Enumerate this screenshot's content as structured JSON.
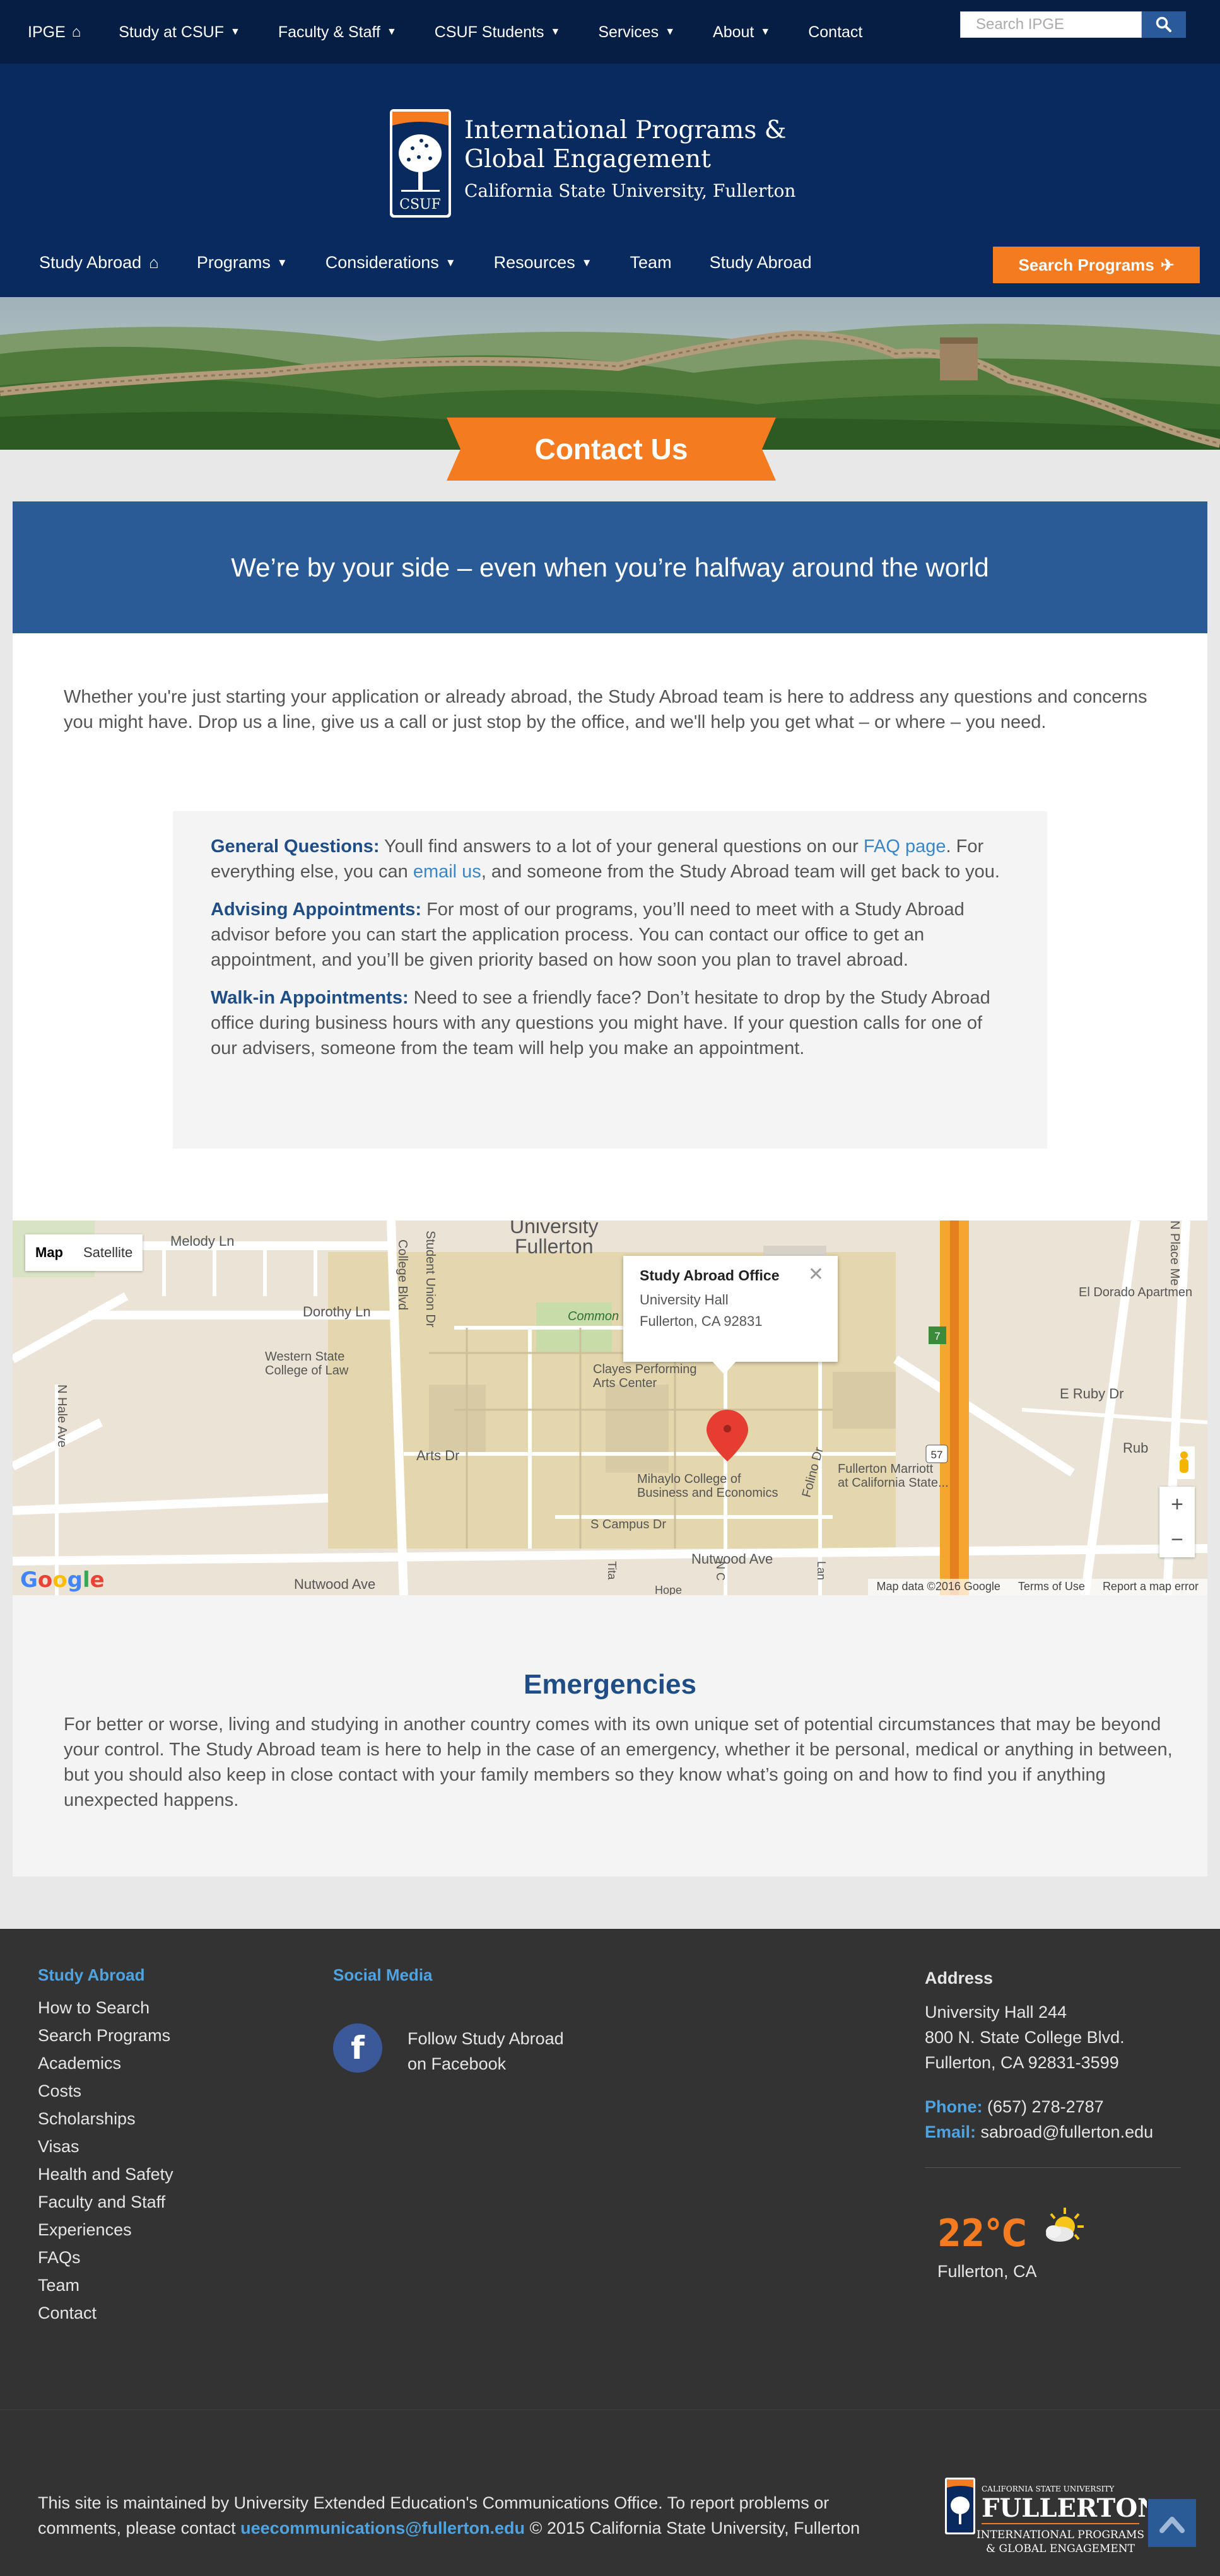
{
  "topbar": {
    "nav": [
      {
        "label": "IPGE",
        "icon": "home-icon"
      },
      {
        "label": "Study at CSUF",
        "icon": "caret-down-icon"
      },
      {
        "label": "Faculty & Staff",
        "icon": "caret-down-icon"
      },
      {
        "label": "CSUF Students",
        "icon": "caret-down-icon"
      },
      {
        "label": "Services",
        "icon": "caret-down-icon"
      },
      {
        "label": "About",
        "icon": "caret-down-icon"
      },
      {
        "label": "Contact",
        "icon": ""
      }
    ],
    "search_placeholder": "Search IPGE"
  },
  "header": {
    "logo_text": "CSUF",
    "title": "International Programs & Global Engagement",
    "subtitle": "California State University, Fullerton",
    "nav": [
      {
        "label": "Study Abroad",
        "icon": "home-icon"
      },
      {
        "label": "Programs",
        "icon": "caret-down-icon"
      },
      {
        "label": "Considerations",
        "icon": "caret-down-icon"
      },
      {
        "label": "Resources",
        "icon": "caret-down-icon"
      },
      {
        "label": "Team",
        "icon": ""
      },
      {
        "label": "Study Abroad",
        "icon": ""
      }
    ],
    "search_programs": "Search Programs"
  },
  "hero": {
    "title": "Contact Us"
  },
  "tagline": "We’re by your side – even when you’re halfway around the world",
  "intro": "Whether you're just starting your application or already abroad, the Study Abroad team is here to address any questions and concerns you might have. Drop us a line, give us a call or just stop by the office, and we'll help you get what – or where – you need.",
  "info": {
    "general": {
      "heading": "General Questions:",
      "text1": " Youll find answers to a lot of your general questions on our ",
      "link1": "FAQ page",
      "text2": ". For everything else, you can ",
      "link2": "email us",
      "text3": ", and someone from the Study Abroad team will get back to you."
    },
    "advising": {
      "heading": "Advising Appointments:",
      "text": " For most of our programs, you’ll need to meet with a Study Abroad advisor before you can start the application process. You can contact our office to get an appointment, and you’ll be given priority based on how soon you plan to travel abroad."
    },
    "walkin": {
      "heading": "Walk-in Appointments:",
      "text": " Need to see a friendly face? Don’t hesitate to drop by the Study Abroad office during business hours with any questions you might have. If your question calls for one of our advisers, someone from the team will help you make an appointment."
    }
  },
  "map": {
    "types": [
      "Map",
      "Satellite"
    ],
    "info_title": "Study Abroad Office",
    "info_lines": [
      "University Hall",
      "Fullerton, CA 92831"
    ],
    "labels": {
      "university": "University",
      "fullerton": "Fullerton",
      "melody": "Melody Ln",
      "dorothy": "Dorothy Ln",
      "western1": "Western State",
      "western2": "College of Law",
      "n_hale": "N Hale Ave",
      "college_blvd": "College Blvd",
      "student_union": "Student Union Dr",
      "arts": "Arts Dr",
      "clayes1": "Clayes Performing",
      "clayes2": "Arts Center",
      "mihaylo1": "Mihaylo College of",
      "mihaylo2": "Business and Economics",
      "campus_dr": "S Campus Dr",
      "nutwood1": "Nutwood Ave",
      "nutwood2": "Nutwood Ave",
      "common": "Common",
      "folino": "Folino Dr",
      "marriott1": "Fullerton Marriott",
      "marriott2": "at California State...",
      "e_ruby": "E Ruby Dr",
      "ruby": "Rub",
      "eldorado": "El Dorado Apartmen",
      "n_place": "N Place Me",
      "hope": "Hope",
      "titan": "Tita",
      "lan": "Lan",
      "nc": "N C",
      "route57": "57",
      "route7": "7"
    },
    "footer": [
      "Map data ©2016 Google",
      "Terms of Use",
      "Report a map error"
    ],
    "google": [
      "G",
      "o",
      "o",
      "g",
      "l",
      "e"
    ]
  },
  "emergencies": {
    "heading": "Emergencies",
    "text": "For better or worse, living and studying in another country comes with its own unique set of potential circumstances that may be beyond your control. The Study Abroad team is here to help in the case of an emergency, whether it be personal, medical or anything in between, but you should also keep in close contact with your family members so they know what’s going on and how to find you if anything unexpected happens."
  },
  "footer": {
    "study_abroad": {
      "heading": "Study Abroad",
      "links": [
        "How to Search",
        "Search Programs",
        "Academics",
        "Costs",
        "Scholarships",
        "Visas",
        "Health and Safety",
        "Faculty and Staff",
        "Experiences",
        "FAQs",
        "Team",
        "Contact"
      ]
    },
    "social": {
      "heading": "Social Media",
      "fb_line1": "Follow Study Abroad",
      "fb_line2": "on Facebook"
    },
    "address": {
      "heading": "Address",
      "lines": [
        "University Hall 244",
        "800 N. State College Blvd.",
        "Fullerton, CA 92831-3599"
      ],
      "phone_label": "Phone:",
      "phone": " (657) 278-2787",
      "email_label": "Email:",
      "email": " sabroad@fullerton.edu"
    },
    "weather": {
      "temp": "22°C",
      "city": "Fullerton, CA"
    },
    "bottom": {
      "text1": "This site is maintained by University Extended Education's Communications Office. To report problems or comments, please contact ",
      "email": "ueecommunications@fullerton.edu",
      "text2": " © 2015 California State University, Fullerton"
    },
    "logo": {
      "line1": "CALIFORNIA STATE UNIVERSITY",
      "line2": "FULLERTON",
      "line3": "INTERNATIONAL PROGRAMS",
      "line4": "& GLOBAL ENGAGEMENT"
    }
  },
  "colors": {
    "navy": "#061d44",
    "header_blue": "#082a5e",
    "band_blue": "#2a5b96",
    "orange": "#f47b20",
    "heading_blue": "#1f4e86",
    "link_blue": "#3b86c6"
  }
}
